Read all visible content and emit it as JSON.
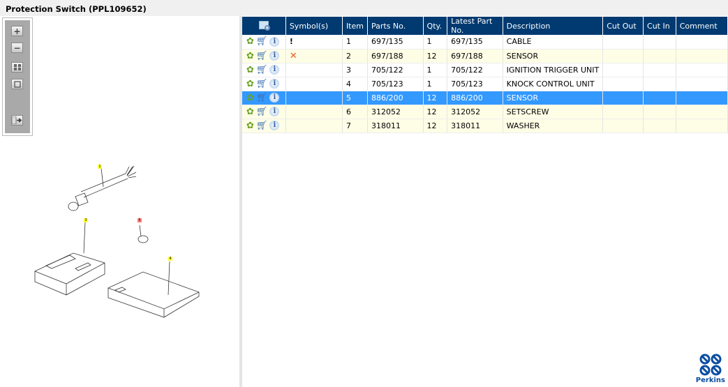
{
  "title": "Protection Switch (PPL109652)",
  "toolbar": {
    "zoom_in": "+",
    "zoom_out": "−",
    "fit": "fit-icon",
    "actual": "actual-size-icon",
    "export": "export-icon"
  },
  "callouts": [
    "1",
    "3",
    "5",
    "4"
  ],
  "table": {
    "headers": [
      "",
      "Symbol(s)",
      "Item",
      "Parts No.",
      "Qty.",
      "Latest Part No.",
      "Description",
      "Cut Out",
      "Cut In",
      "Comment"
    ],
    "rows": [
      {
        "symbol": "!",
        "item": "1",
        "part": "697/135",
        "qty": "1",
        "latest": "697/135",
        "desc": "CABLE",
        "cutout": "",
        "cutin": "",
        "comment": ""
      },
      {
        "symbol": "✕",
        "item": "2",
        "part": "697/188",
        "qty": "12",
        "latest": "697/188",
        "desc": "SENSOR",
        "cutout": "",
        "cutin": "",
        "comment": ""
      },
      {
        "symbol": "",
        "item": "3",
        "part": "705/122",
        "qty": "1",
        "latest": "705/122",
        "desc": "IGNITION TRIGGER UNIT",
        "cutout": "",
        "cutin": "",
        "comment": ""
      },
      {
        "symbol": "",
        "item": "4",
        "part": "705/123",
        "qty": "1",
        "latest": "705/123",
        "desc": "KNOCK CONTROL UNIT",
        "cutout": "",
        "cutin": "",
        "comment": ""
      },
      {
        "symbol": "",
        "item": "5",
        "part": "886/200",
        "qty": "12",
        "latest": "886/200",
        "desc": "SENSOR",
        "cutout": "",
        "cutin": "",
        "comment": ""
      },
      {
        "symbol": "",
        "item": "6",
        "part": "312052",
        "qty": "12",
        "latest": "312052",
        "desc": "SETSCREW",
        "cutout": "",
        "cutin": "",
        "comment": ""
      },
      {
        "symbol": "",
        "item": "7",
        "part": "318011",
        "qty": "12",
        "latest": "318011",
        "desc": "WASHER",
        "cutout": "",
        "cutin": "",
        "comment": ""
      }
    ]
  },
  "logo": "Perkins",
  "colors": {
    "header": "#003a70",
    "selected": "#3399ff",
    "alt_row": "#fefee6"
  }
}
